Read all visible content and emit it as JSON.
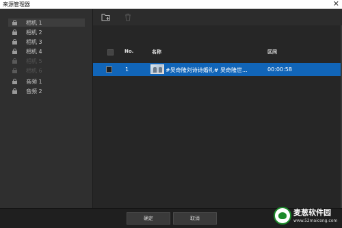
{
  "window": {
    "title": "来源管理器",
    "close_glyph": "✕"
  },
  "sidebar": {
    "items": [
      {
        "label": "相机 1",
        "icon": "lock-icon",
        "selected": true,
        "disabled": false
      },
      {
        "label": "相机 2",
        "icon": "lock-icon",
        "selected": false,
        "disabled": false
      },
      {
        "label": "相机 3",
        "icon": "lock-icon",
        "selected": false,
        "disabled": false
      },
      {
        "label": "相机 4",
        "icon": "lock-icon",
        "selected": false,
        "disabled": false
      },
      {
        "label": "相机 5",
        "icon": "lock-icon",
        "selected": false,
        "disabled": true
      },
      {
        "label": "相机 6",
        "icon": "lock-icon",
        "selected": false,
        "disabled": true
      },
      {
        "label": "音频 1",
        "icon": "lock-icon",
        "selected": false,
        "disabled": false
      },
      {
        "label": "音频 2",
        "icon": "lock-icon",
        "selected": false,
        "disabled": false
      }
    ]
  },
  "toolbar": {
    "add_icon": "add-folder-icon",
    "delete_icon": "trash-icon"
  },
  "table": {
    "headers": {
      "no": "No.",
      "name": "名称",
      "interval": "区间"
    },
    "rows": [
      {
        "no": "1",
        "name": "#吴奇隆刘诗诗婚礼# 吴奇隆世...",
        "interval": "00:00:58",
        "selected": true
      }
    ]
  },
  "footer": {
    "ok_label": "确定",
    "cancel_label": "取消"
  },
  "watermark": {
    "brand": "麦葱软件园",
    "url": "www.52maicong.com"
  },
  "colors": {
    "selection": "#1165b8",
    "background": "#262626",
    "watermark_green": "#1c8a2a"
  }
}
